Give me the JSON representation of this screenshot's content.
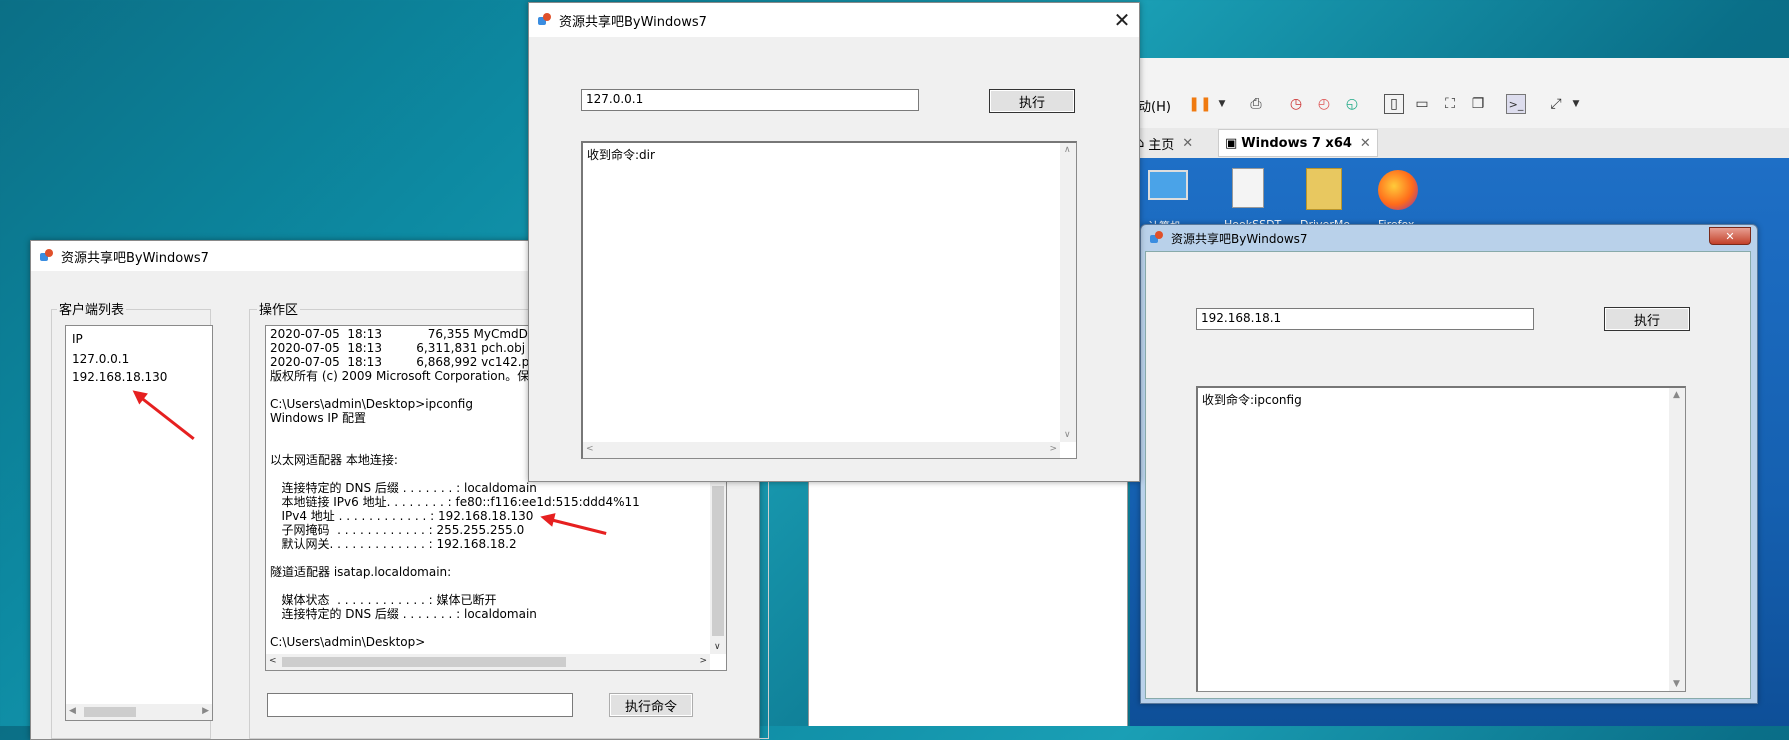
{
  "colors": {
    "accent": "#e62020",
    "window_bg": "#f0f0f0",
    "vm_desktop": "#1560b0"
  },
  "top_window": {
    "title": "资源共享吧ByWindows7",
    "ip_value": "127.0.0.1",
    "exec_label": "执行",
    "output": "收到命令:dir"
  },
  "left_window": {
    "title": "资源共享吧ByWindows7",
    "clients_label": "客户端列表",
    "clients": [
      "IP",
      "127.0.0.1",
      "192.168.18.130"
    ],
    "ops_label": "操作区",
    "console_lines": [
      "2020-07-05  18:13            76,355 MyCmdDlg.o",
      "2020-07-05  18:13         6,311,831 pch.obj",
      "2020-07-05  18:13         6,868,992 vc142.pdb",
      "版权所有 (c) 2009 Microsoft Corporation。保留所",
      "",
      "C:\\Users\\admin\\Desktop>ipconfig",
      "Windows IP 配置",
      "",
      "",
      "以太网适配器 本地连接:",
      "",
      "   连接特定的 DNS 后缀 . . . . . . . : localdomain",
      "   本地链接 IPv6 地址. . . . . . . . : fe80::f116:ee1d:515:ddd4%11",
      "   IPv4 地址 . . . . . . . . . . . . : 192.168.18.130",
      "   子网掩码  . . . . . . . . . . . . : 255.255.255.0",
      "   默认网关. . . . . . . . . . . . . : 192.168.18.2",
      "",
      "隧道适配器 isatap.localdomain:",
      "",
      "   媒体状态  . . . . . . . . . . . . : 媒体已断开",
      "   连接特定的 DNS 后缀 . . . . . . . : localdomain",
      "",
      "C:\\Users\\admin\\Desktop>"
    ],
    "command_value": "",
    "exec_command_label": "执行命令"
  },
  "vm": {
    "menu_fragment": "动(H)",
    "tabs": {
      "home": "主页",
      "vm": "Windows 7 x64"
    },
    "desktop_icons": [
      "计算机",
      "HookSSDT",
      "DriverMo",
      "Firefox"
    ]
  },
  "right_window": {
    "title": "资源共享吧ByWindows7",
    "ip_value": "192.168.18.1",
    "exec_label": "执行",
    "output": "收到命令:ipconfig"
  }
}
